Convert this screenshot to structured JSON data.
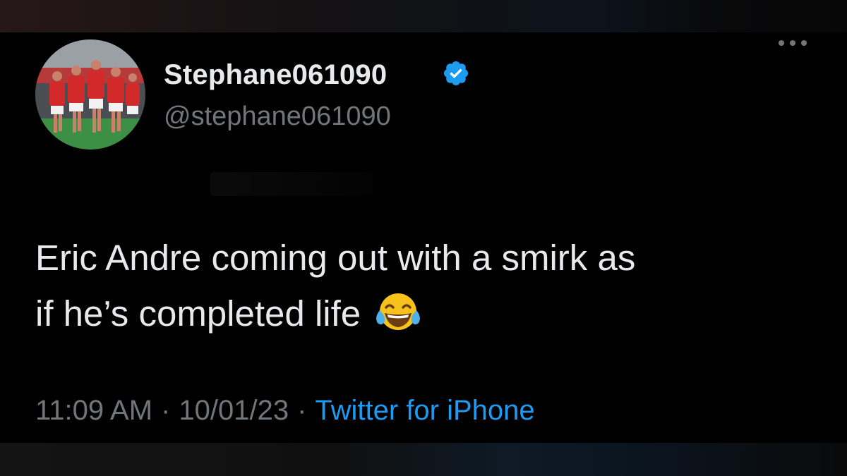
{
  "tweet": {
    "author": {
      "display_name": "Stephane061090",
      "handle": "@stephane061090",
      "verified": true,
      "avatar": "team-celebration-photo"
    },
    "text_line1": "Eric Andre coming out with a smirk as",
    "text_line2": "if he’s completed life",
    "emoji": "face-with-tears-of-joy",
    "time": "11:09 AM",
    "date": "10/01/23",
    "separator": "·",
    "source": "Twitter for iPhone",
    "more_icon": "more-options-icon"
  },
  "colors": {
    "background": "#000000",
    "primary_text": "#e7e9ea",
    "secondary_text": "#71767b",
    "accent": "#1d9bf0",
    "verified_badge": "#1d9bf0"
  }
}
